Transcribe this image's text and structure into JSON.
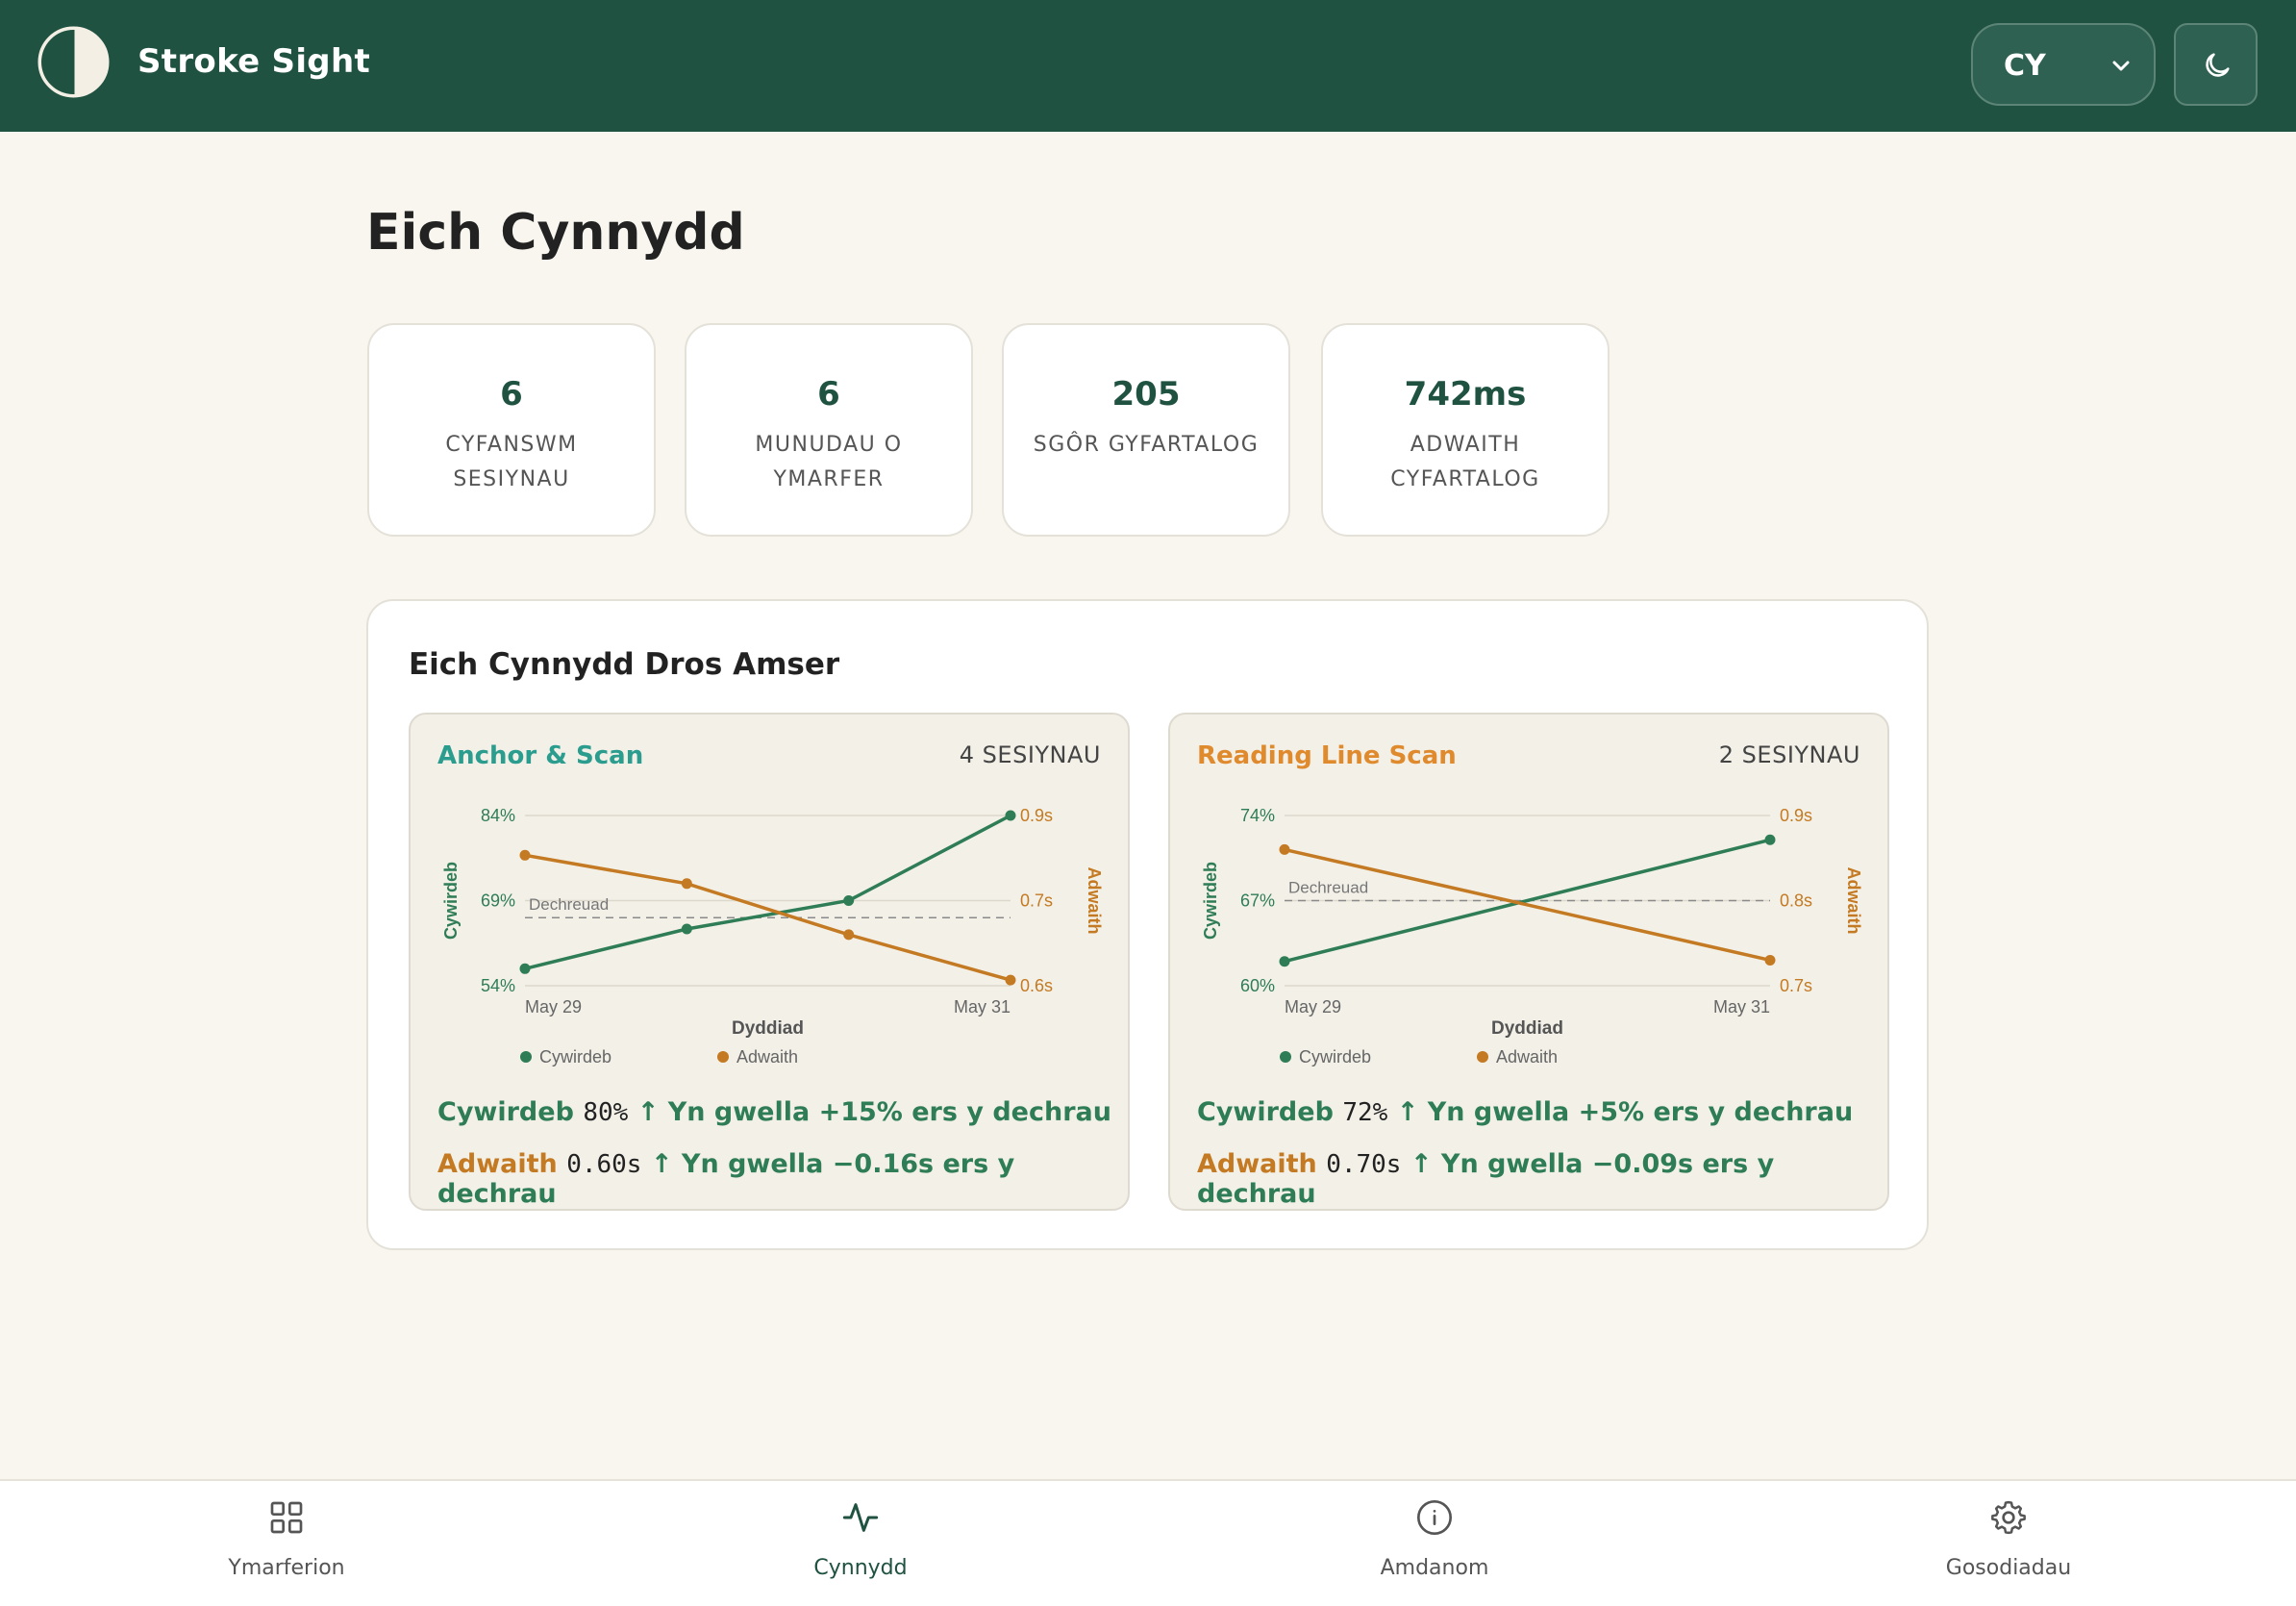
{
  "app": {
    "title": "Stroke Sight"
  },
  "header": {
    "language": "CY"
  },
  "page": {
    "title": "Eich Cynnydd"
  },
  "stats": [
    {
      "value": "6",
      "label": "CYFANSWM SESIYNAU"
    },
    {
      "value": "6",
      "label": "MUNUDAU O YMARFER"
    },
    {
      "value": "205",
      "label": "SGÔR GYFARTALOG"
    },
    {
      "value": "742ms",
      "label": "ADWAITH CYFARTALOG"
    }
  ],
  "progress": {
    "title": "Eich Cynnydd Dros Amser",
    "exercises": [
      {
        "name": "Anchor & Scan",
        "name_color": "#2a9d8f",
        "sessions": "4 SESIYNAU",
        "accuracy_label": "Cywirdeb",
        "accuracy_value": "80%",
        "accuracy_change": "↑ Yn gwella +15% ers y dechrau",
        "reaction_label": "Adwaith",
        "reaction_value": "0.60s",
        "reaction_change": "↑ Yn gwella −0.16s ers y dechrau"
      },
      {
        "name": "Reading Line Scan",
        "name_color": "#e08a2e",
        "sessions": "2 SESIYNAU",
        "accuracy_label": "Cywirdeb",
        "accuracy_value": "72%",
        "accuracy_change": "↑ Yn gwella +5% ers y dechrau",
        "reaction_label": "Adwaith",
        "reaction_value": "0.70s",
        "reaction_change": "↑ Yn gwella −0.09s ers y dechrau"
      }
    ]
  },
  "chart_data": [
    {
      "type": "line",
      "xlabel": "Dyddiad",
      "ylabel_left": "Cywirdeb",
      "ylabel_right": "Adwaith",
      "x_tick_labels": [
        "May 29",
        "May 31"
      ],
      "left_ticks": [
        "84%",
        "69%",
        "54%"
      ],
      "right_ticks": [
        "0.9s",
        "0.7s",
        "0.6s"
      ],
      "baseline_label": "Dechreuad",
      "left_ylim": [
        54,
        84
      ],
      "right_ylim": [
        0.6,
        0.9
      ],
      "series": [
        {
          "name": "Cywirdeb",
          "axis": "left",
          "color": "#2e7d56",
          "values": [
            57,
            64,
            69,
            84
          ]
        },
        {
          "name": "Adwaith",
          "axis": "right",
          "color": "#c47a22",
          "values": [
            0.83,
            0.78,
            0.69,
            0.61
          ]
        }
      ],
      "baseline": {
        "axis": "left",
        "value": 66
      },
      "legend": "bottom"
    },
    {
      "type": "line",
      "xlabel": "Dyddiad",
      "ylabel_left": "Cywirdeb",
      "ylabel_right": "Adwaith",
      "x_tick_labels": [
        "May 29",
        "May 31"
      ],
      "left_ticks": [
        "74%",
        "67%",
        "60%"
      ],
      "right_ticks": [
        "0.9s",
        "0.8s",
        "0.7s"
      ],
      "baseline_label": "Dechreuad",
      "left_ylim": [
        60,
        74
      ],
      "right_ylim": [
        0.7,
        0.9
      ],
      "series": [
        {
          "name": "Cywirdeb",
          "axis": "left",
          "color": "#2e7d56",
          "values": [
            62,
            72
          ]
        },
        {
          "name": "Adwaith",
          "axis": "right",
          "color": "#c47a22",
          "values": [
            0.86,
            0.73
          ]
        }
      ],
      "baseline": {
        "axis": "left",
        "value": 67
      },
      "legend": "bottom"
    }
  ],
  "nav": [
    {
      "label": "Ymarferion",
      "icon": "grid-icon"
    },
    {
      "label": "Cynnydd",
      "icon": "activity-icon",
      "active": true
    },
    {
      "label": "Amdanom",
      "icon": "info-icon"
    },
    {
      "label": "Gosodiadau",
      "icon": "gear-icon"
    }
  ],
  "colors": {
    "brand": "#205242",
    "accuracy": "#2e7d56",
    "reaction": "#c47a22"
  }
}
